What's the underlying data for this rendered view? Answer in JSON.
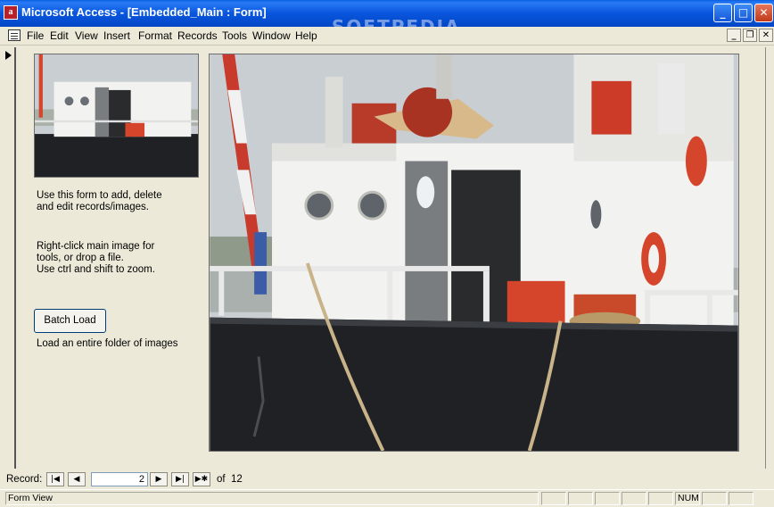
{
  "window": {
    "app_icon_letter": "a",
    "title": "Microsoft Access - [Embedded_Main : Form]",
    "minimize_label": "_",
    "maximize_label": "□",
    "close_label": "✕",
    "watermark": "SOFTPEDIA"
  },
  "menu": {
    "items": [
      {
        "label": "File"
      },
      {
        "label": "Edit"
      },
      {
        "label": "View"
      },
      {
        "label": "Insert"
      },
      {
        "label": "Format"
      },
      {
        "label": "Records"
      },
      {
        "label": "Tools"
      },
      {
        "label": "Window"
      },
      {
        "label": "Help"
      }
    ],
    "doc_minimize_label": "_",
    "doc_restore_label": "❐",
    "doc_close_label": "✕"
  },
  "form": {
    "instructions_1": [
      "Use this form to add, delete",
      "and edit records/images."
    ],
    "instructions_2": [
      "Right-click main image for",
      "tools, or drop a file.",
      "Use ctrl and shift to zoom."
    ],
    "batch_button_label": "Batch Load",
    "batch_caption": "Load an entire folder of images",
    "thumbnail_icon": "ship-photo-thumbnail",
    "main_image_icon": "ship-photo"
  },
  "navigation": {
    "label": "Record:",
    "first_icon": "|◀",
    "prev_icon": "◀",
    "current_record": "2",
    "next_icon": "▶",
    "last_icon": "▶|",
    "new_icon": "▶✱",
    "of_label": "of",
    "total_records": "12"
  },
  "status": {
    "view": "Form View",
    "num": "NUM"
  },
  "colors": {
    "title_bar": "#0855dd",
    "face": "#ece9d8",
    "sky": "#c9ced3",
    "hull": "#1f2125",
    "superstructure": "#f2f2f0",
    "accent_red": "#d5452b"
  }
}
